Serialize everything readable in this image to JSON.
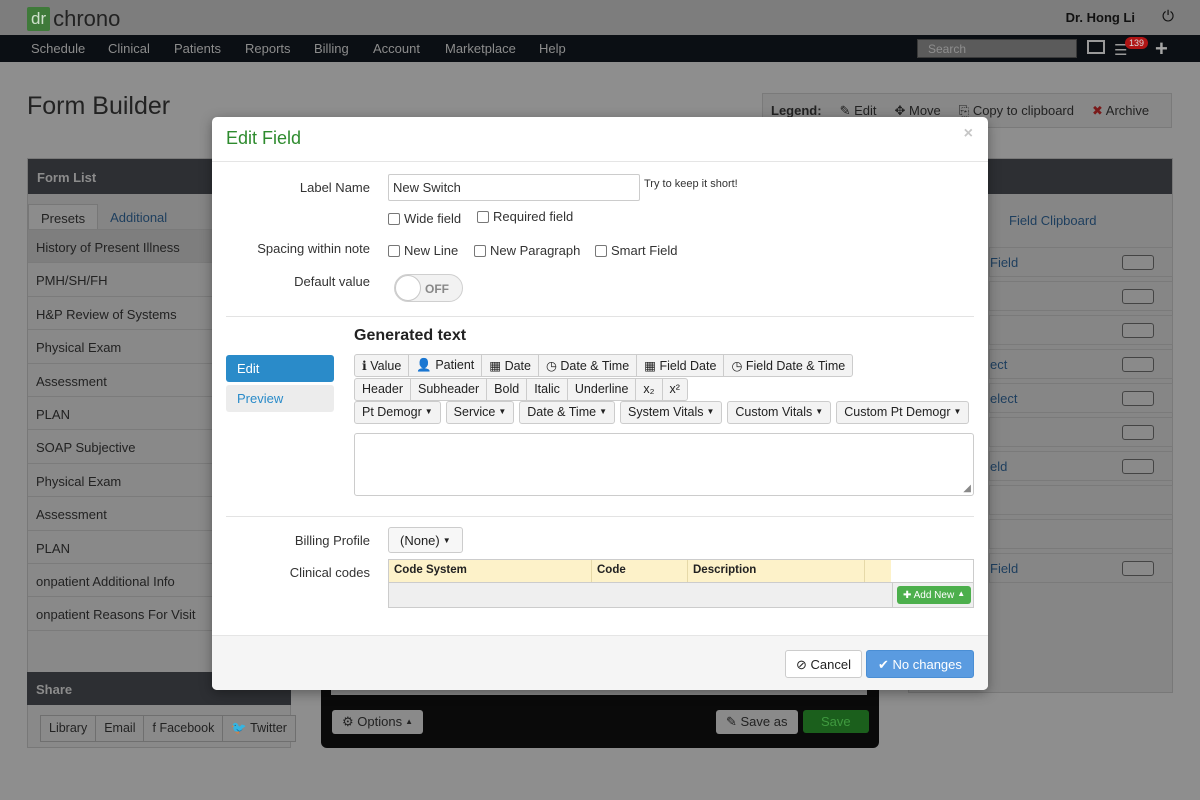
{
  "app": {
    "logo_box": "dr",
    "logo_text": "chrono",
    "user": "Dr. Hong Li",
    "power_icon": "⏻"
  },
  "nav": {
    "items": [
      "Schedule",
      "Clinical",
      "Patients",
      "Reports",
      "Billing",
      "Account",
      "Marketplace",
      "Help"
    ],
    "search_placeholder": "Search",
    "badge": "139"
  },
  "page": {
    "title": "Form Builder",
    "legend": {
      "title": "Legend:",
      "edit": "Edit",
      "move": "Move",
      "copy": "Copy to clipboard",
      "archive": "Archive"
    }
  },
  "form_list": {
    "header": "Form List",
    "tabs": [
      "Presets",
      "Additional"
    ],
    "items": [
      "History of Present Illness",
      "PMH/SH/FH",
      "H&P Review of Systems",
      "Physical Exam",
      "Assessment",
      "PLAN",
      "SOAP Subjective",
      "Physical Exam",
      "Assessment",
      "PLAN",
      "onpatient Additional Info",
      "onpatient Reasons For Visit"
    ]
  },
  "share": {
    "header": "Share",
    "buttons": [
      "Library",
      "Email",
      "Facebook",
      "Twitter"
    ]
  },
  "right_panel": {
    "tab": "Field Clipboard",
    "items": [
      "Field",
      "",
      "",
      "ect",
      "elect",
      "",
      "eld",
      "",
      "",
      "Field"
    ]
  },
  "center": {
    "options": "Options",
    "save_as": "Save as",
    "save": "Save"
  },
  "modal": {
    "title": "Edit Field",
    "close": "×",
    "label_name": "Label Name",
    "label_value": "New Switch",
    "hint": "Try to keep it short!",
    "wide_field": "Wide field",
    "required_field": "Required field",
    "spacing_label": "Spacing within note",
    "new_line": "New Line",
    "new_paragraph": "New Paragraph",
    "smart_field": "Smart Field",
    "default_value": "Default value",
    "toggle": "OFF",
    "generated_text": "Generated text",
    "side_tabs": {
      "edit": "Edit",
      "preview": "Preview"
    },
    "insert_row": [
      {
        "icon": "ℹ",
        "label": "Value"
      },
      {
        "icon": "👤",
        "label": "Patient"
      },
      {
        "icon": "▦",
        "label": "Date"
      },
      {
        "icon": "◷",
        "label": "Date & Time"
      },
      {
        "icon": "▦",
        "label": "Field Date"
      },
      {
        "icon": "◷",
        "label": "Field Date & Time"
      }
    ],
    "format_row": [
      "Header",
      "Subheader",
      "Bold",
      "Italic",
      "Underline",
      "x₂",
      "x²"
    ],
    "dropdown_row": [
      "Pt Demogr",
      "Service",
      "Date & Time",
      "System Vitals",
      "Custom Vitals",
      "Custom Pt Demogr"
    ],
    "billing_label": "Billing Profile",
    "billing_value": "(None)",
    "clinical_label": "Clinical codes",
    "codes_columns": [
      "Code System",
      "Code",
      "Description"
    ],
    "add_new": "Add New",
    "cancel": "Cancel",
    "save": "No changes"
  }
}
